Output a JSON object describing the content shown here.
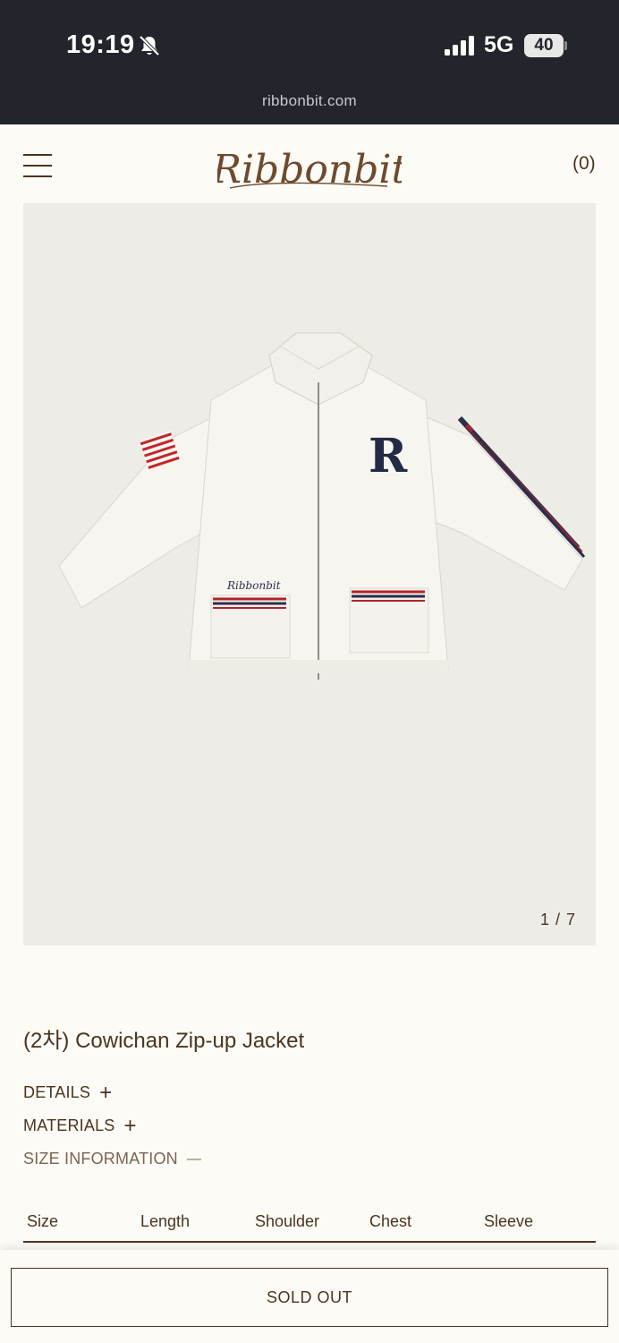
{
  "status_bar": {
    "time": "19:19",
    "network": "5G",
    "battery": "40"
  },
  "browser": {
    "url": "ribbonbit.com"
  },
  "header": {
    "logo_text": "Ribbonbit",
    "cart_label": "(0)"
  },
  "gallery": {
    "counter": "1 / 7",
    "image_description": "white knit zip-up jacket with navy R letter and striped trims",
    "jacket_embroidery": "Ribbonbit",
    "jacket_letter": "R"
  },
  "product": {
    "title": "(2차) Cowichan Zip-up Jacket",
    "accordions": [
      {
        "label": "DETAILS",
        "symbol": "+"
      },
      {
        "label": "MATERIALS",
        "symbol": "+"
      },
      {
        "label": "SIZE INFORMATION",
        "symbol": "—"
      }
    ],
    "size_table_headers": [
      "Size",
      "Length",
      "Shoulder",
      "Chest",
      "Sleeve"
    ]
  },
  "actions": {
    "sold_out_label": "SOLD OUT"
  },
  "colors": {
    "brand_brown": "#4a3422",
    "background": "#fcfbf5",
    "status_bar": "#22252b",
    "gallery_bg": "#edece6"
  }
}
